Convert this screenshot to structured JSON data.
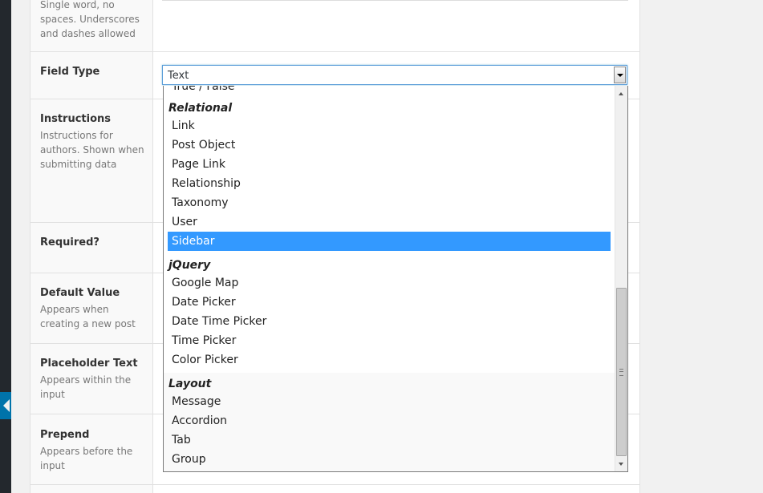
{
  "settings": {
    "fields": [
      {
        "title": "",
        "desc": "Single word, no spaces. Underscores and dashes allowed"
      },
      {
        "title": "Field Type",
        "desc": ""
      },
      {
        "title": "Instructions",
        "desc": "Instructions for authors. Shown when submitting data"
      },
      {
        "title": "Required?",
        "desc": ""
      },
      {
        "title": "Default Value",
        "desc": "Appears when creating a new post"
      },
      {
        "title": "Placeholder Text",
        "desc": "Appears within the input"
      },
      {
        "title": "Prepend",
        "desc": "Appears before the input"
      }
    ]
  },
  "select": {
    "value": "Text"
  },
  "dropdown": {
    "partial_option": "True / False",
    "groups": [
      {
        "label": "Relational",
        "options": [
          "Link",
          "Post Object",
          "Page Link",
          "Relationship",
          "Taxonomy",
          "User",
          "Sidebar"
        ]
      },
      {
        "label": "jQuery",
        "options": [
          "Google Map",
          "Date Picker",
          "Date Time Picker",
          "Time Picker",
          "Color Picker"
        ]
      },
      {
        "label": "Layout",
        "options": [
          "Message",
          "Accordion",
          "Tab",
          "Group"
        ]
      }
    ],
    "selected": "Sidebar"
  },
  "colors": {
    "selected_bg": "#3399ff",
    "admin_accent": "#0073aa"
  }
}
